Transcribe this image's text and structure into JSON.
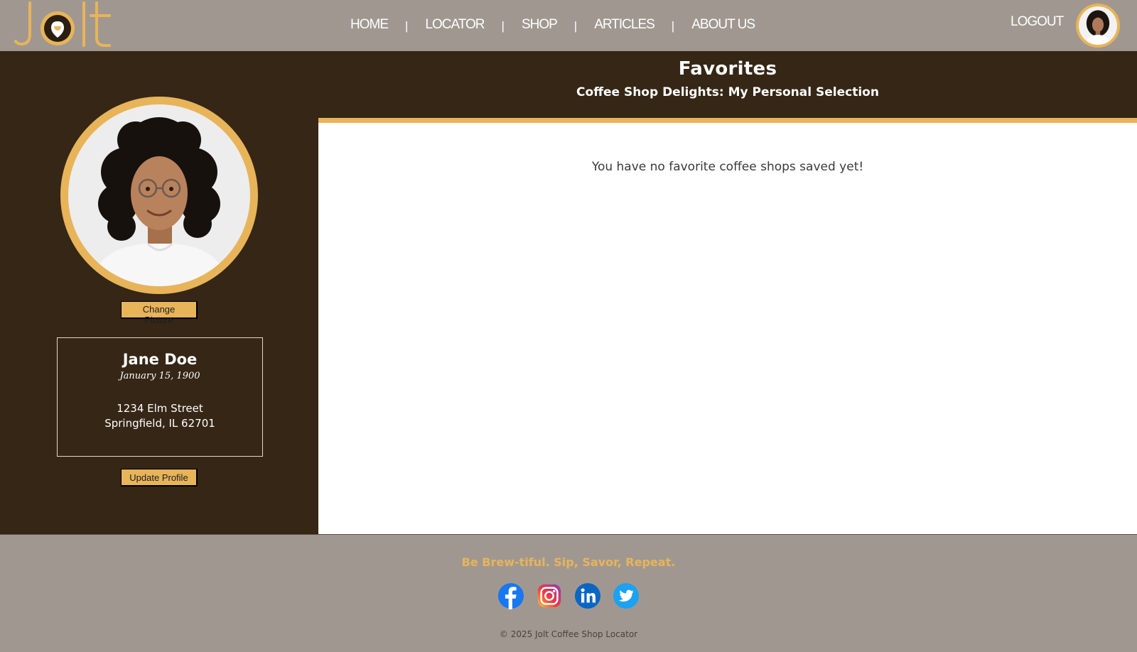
{
  "header": {
    "logo_text": "Jolt",
    "nav": [
      {
        "label": "HOME"
      },
      {
        "label": "LOCATOR"
      },
      {
        "label": "SHOP"
      },
      {
        "label": "ARTICLES"
      },
      {
        "label": "ABOUT US"
      }
    ],
    "nav_separator": "|",
    "logout_label": "LOGOUT"
  },
  "profile": {
    "change_picture_label": "Change Picture",
    "name": "Jane Doe",
    "dob": "January 15, 1900",
    "address_line1": "1234 Elm Street",
    "address_line2": "Springfield, IL 62701",
    "update_label": "Update Profile"
  },
  "main": {
    "title": "Favorites",
    "subtitle": "Coffee Shop Delights: My Personal Selection",
    "empty_message": "You have no favorite coffee shops saved yet!"
  },
  "footer": {
    "tagline": "Be Brew-tiful. Sip, Savor, Repeat.",
    "social": [
      {
        "icon": "facebook-icon"
      },
      {
        "icon": "instagram-icon"
      },
      {
        "icon": "linkedin-icon"
      },
      {
        "icon": "twitter-icon"
      }
    ],
    "copyright": "© 2025 Jolt Coffee Shop Locator"
  },
  "colors": {
    "accent": "#e8b45a",
    "dark_brown": "#352616",
    "header_gray": "#a09890"
  }
}
